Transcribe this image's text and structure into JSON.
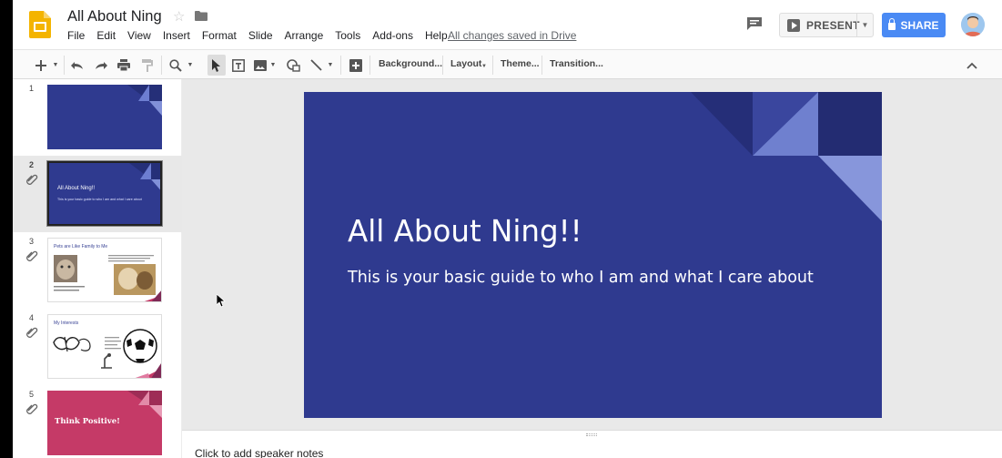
{
  "app": {
    "title": "All About Ning",
    "menu": [
      "File",
      "Edit",
      "View",
      "Insert",
      "Format",
      "Slide",
      "Arrange",
      "Tools",
      "Add-ons",
      "Help"
    ],
    "save_status": "All changes saved in Drive",
    "present_label": "PRESENT",
    "share_label": "SHARE",
    "colors": {
      "docs_yellow": "#f4b400",
      "share_blue": "#4a8af4",
      "slide_navy": "#2f3a8f",
      "accent_pink": "#c53a67"
    }
  },
  "toolbar": {
    "background_label": "Background...",
    "layout_label": "Layout",
    "theme_label": "Theme...",
    "transition_label": "Transition...",
    "icons": [
      "plus-icon",
      "undo-icon",
      "redo-icon",
      "print-icon",
      "paint-format-icon",
      "zoom-icon",
      "select-icon",
      "text-box-icon",
      "image-icon",
      "shape-icon",
      "line-icon",
      "comment-add-icon",
      "collapse-icon"
    ]
  },
  "filmstrip": {
    "slides": [
      {
        "num": "1",
        "title": "",
        "subtitle": ""
      },
      {
        "num": "2",
        "title": "All About Ning!!",
        "subtitle": "This is your basic guide to who I am and what I care about"
      },
      {
        "num": "3",
        "title": "Pets are Like Family to Me",
        "subtitle": ""
      },
      {
        "num": "4",
        "title": "My Interests",
        "subtitle": ""
      },
      {
        "num": "5",
        "title": "Think Positive!",
        "subtitle": ""
      }
    ],
    "selected_index": 1
  },
  "slide": {
    "title": "All About Ning!!",
    "subtitle": "This is your basic guide to who I am and what I care about"
  },
  "notes": {
    "placeholder": "Click to add speaker notes"
  }
}
